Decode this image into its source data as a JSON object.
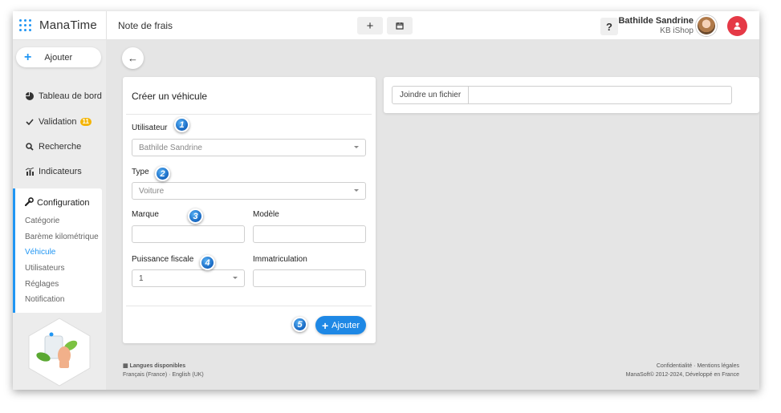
{
  "app": {
    "logo_text": "ManaTime",
    "page_title": "Note de frais",
    "plus_label": "+",
    "help_label": "?"
  },
  "user": {
    "name": "Bathilde Sandrine",
    "company": "KB iShop"
  },
  "sidebar": {
    "add_label": "Ajouter",
    "items": [
      {
        "label": "Tableau de bord",
        "icon": "pie-chart-icon"
      },
      {
        "label": "Validation",
        "icon": "check-icon",
        "badge": "11"
      },
      {
        "label": "Recherche",
        "icon": "search-icon"
      },
      {
        "label": "Indicateurs",
        "icon": "indicators-icon"
      }
    ],
    "config": {
      "title": "Configuration",
      "items": [
        "Catégorie",
        "Barème kilométrique",
        "Véhicule",
        "Utilisateurs",
        "Réglages",
        "Notification"
      ],
      "active": "Véhicule"
    }
  },
  "form": {
    "title": "Créer un véhicule",
    "fields": {
      "user": {
        "label": "Utilisateur",
        "value": "Bathilde Sandrine"
      },
      "type": {
        "label": "Type",
        "value": "Voiture"
      },
      "brand": {
        "label": "Marque",
        "value": ""
      },
      "model": {
        "label": "Modèle",
        "value": ""
      },
      "fiscal_power": {
        "label": "Puissance fiscale",
        "value": "1"
      },
      "registration": {
        "label": "Immatriculation",
        "value": ""
      }
    },
    "submit_label": "Ajouter",
    "markers": [
      "1",
      "2",
      "3",
      "4",
      "5"
    ]
  },
  "attachment": {
    "button_label": "Joindre un fichier"
  },
  "footer": {
    "languages_title": "Langues disponibles",
    "languages": "Français (France) · English (UK)",
    "links": "Confidentialité · Mentions légales",
    "copyright": "ManaSoft© 2012-2024, Développé en France"
  },
  "colors": {
    "accent": "#2196f3",
    "primary_button": "#1e88e5",
    "badge": "#f4b400",
    "alert": "#e53946"
  }
}
